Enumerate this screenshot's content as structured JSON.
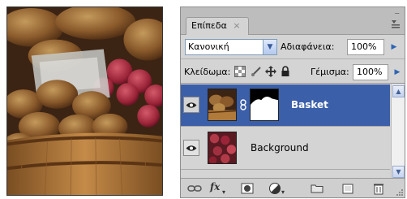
{
  "panel": {
    "tab_label": "Επίπεδα",
    "tab_close": "×",
    "minimize_label": "–"
  },
  "blend": {
    "mode": "Κανονική",
    "opacity_label": "Αδιαφάνεια:",
    "opacity_value": "100%"
  },
  "lock": {
    "label": "Κλείδωμα:",
    "fill_label": "Γέμισμα:",
    "fill_value": "100%"
  },
  "layers": [
    {
      "name": "Basket",
      "selected": true,
      "visible": true,
      "has_mask": true
    },
    {
      "name": "Background",
      "selected": false,
      "visible": true,
      "has_mask": false
    }
  ],
  "bottom_bar": {
    "fx_label": "fx",
    "icons": [
      "link-layers-icon",
      "fx-icon",
      "add-mask-icon",
      "adjustment-layer-icon",
      "new-group-icon",
      "new-layer-icon",
      "trash-icon"
    ]
  },
  "colors": {
    "selection": "#3b5fa8",
    "panel_bg": "#d4d4d4",
    "accent_arrow": "#2f64b4"
  }
}
